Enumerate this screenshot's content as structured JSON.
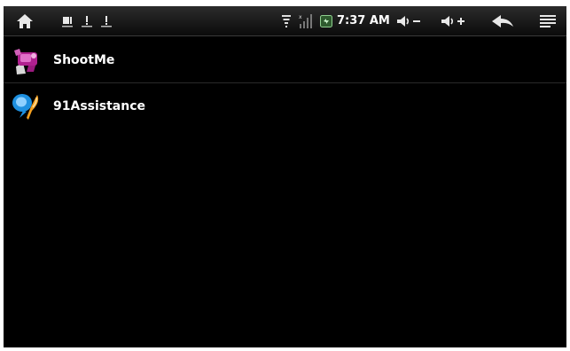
{
  "status_bar": {
    "time": "7:37 AM",
    "left_icons": [
      "home-icon",
      "notification-screenshot-icon",
      "notification-usb-icon",
      "notification-usb-debug-icon"
    ],
    "right_icons": [
      "wifi-icon",
      "signal-icon",
      "battery-icon"
    ],
    "buttons": [
      "volume-down-icon",
      "volume-up-icon",
      "back-icon",
      "menu-icon"
    ]
  },
  "apps": [
    {
      "label": "ShootMe",
      "icon": "shootme-app-icon"
    },
    {
      "label": "91Assistance",
      "icon": "91assistance-app-icon"
    }
  ],
  "colors": {
    "background": "#000000",
    "status_bar": "#1a1a1a",
    "text": "#ffffff",
    "shootme_accent": "#b0208f",
    "assistance_blue": "#1e90e0",
    "assistance_orange": "#f5a020"
  }
}
